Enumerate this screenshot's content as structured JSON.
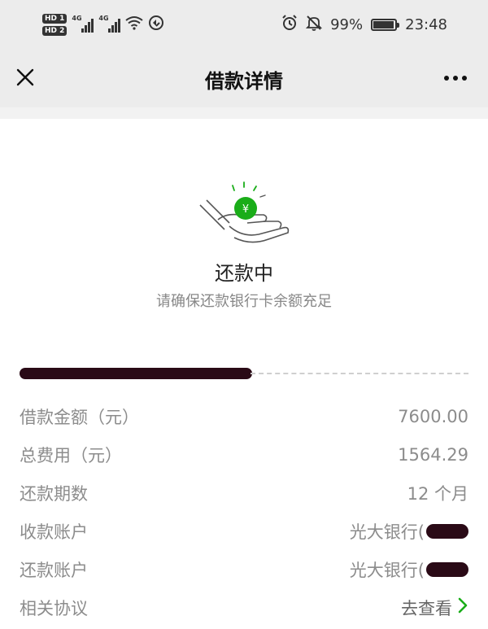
{
  "status_bar": {
    "hd1": "HD 1",
    "hd2": "HD 2",
    "net1": "4G",
    "net2": "4G",
    "battery": "99%",
    "time": "23:48",
    "icons": [
      "signal-icon",
      "wifi-icon",
      "sync-icon",
      "alarm-icon",
      "mute-icon",
      "battery-icon"
    ]
  },
  "nav": {
    "title": "借款详情",
    "icons": [
      "close-icon",
      "more-icon"
    ]
  },
  "status": {
    "title": "还款中",
    "subtitle": "请确保还款银行卡余额充足",
    "icon": "hand-coin-icon",
    "coin_symbol": "¥"
  },
  "details": [
    {
      "label": "借款金额（元）",
      "value": "7600.00"
    },
    {
      "label": "总费用（元）",
      "value": "1564.29"
    },
    {
      "label": "还款期数",
      "value": "12 个月"
    },
    {
      "label": "收款账户",
      "value": "光大银行(",
      "masked": true
    },
    {
      "label": "还款账户",
      "value": "光大银行(",
      "masked": true
    },
    {
      "label": "相关协议",
      "value": "去查看",
      "link": true
    }
  ],
  "colors": {
    "accent_green": "#1aad19",
    "nav_bg": "#ececec",
    "redaction": "#2a0a16"
  }
}
